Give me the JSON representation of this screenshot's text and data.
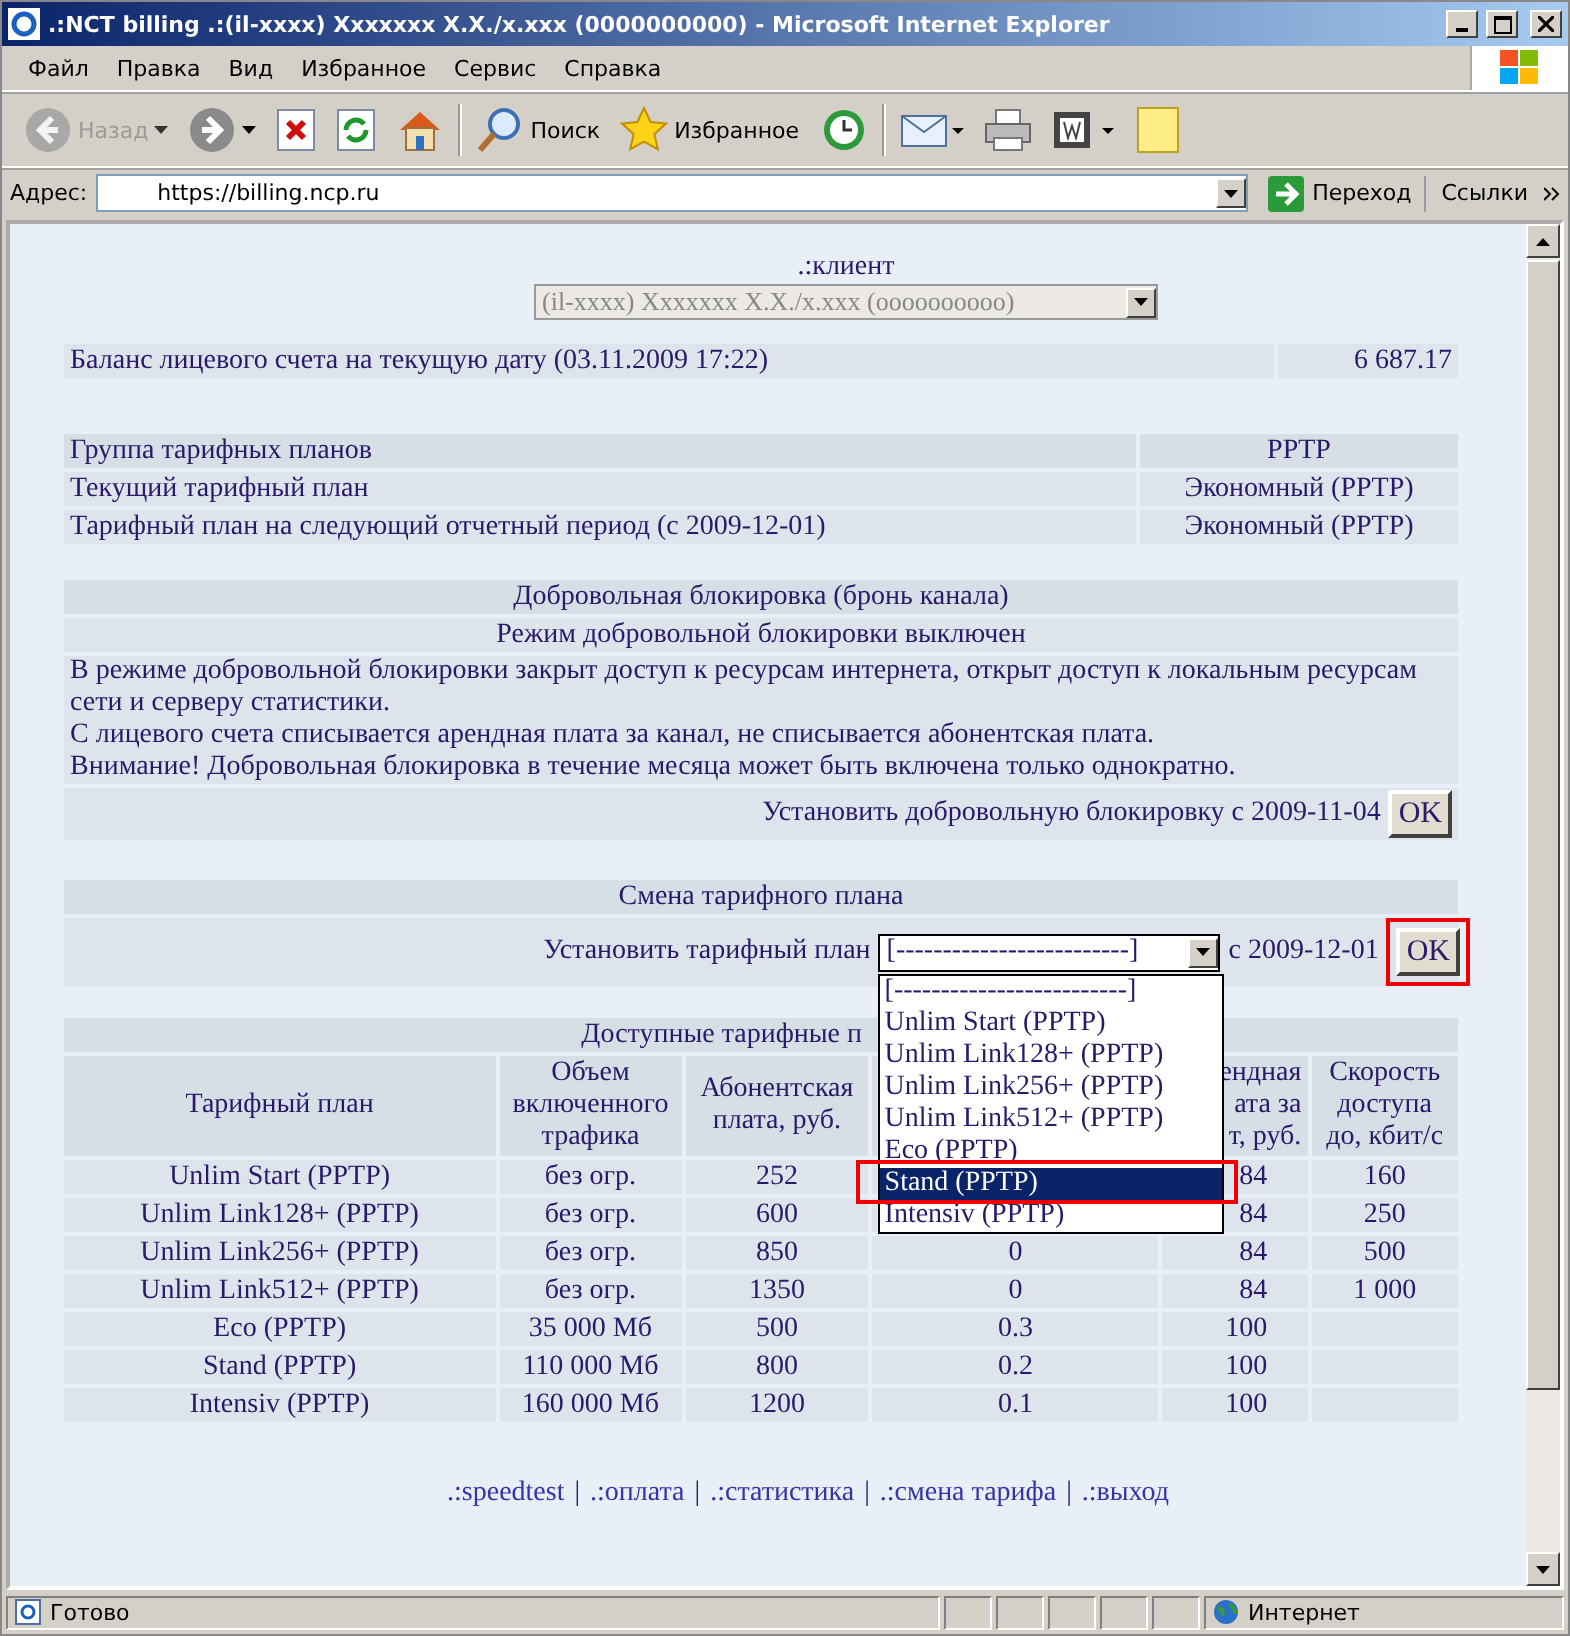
{
  "window": {
    "title": ".:NCT billing .:(il-xxxx) Xxxxxxx X.X./x.xxx (0000000000) - Microsoft Internet Explorer"
  },
  "menu": [
    "Файл",
    "Правка",
    "Вид",
    "Избранное",
    "Сервис",
    "Справка"
  ],
  "toolbar": [
    {
      "kind": "back",
      "label": "Назад",
      "disabled": true
    },
    {
      "kind": "forward",
      "disabled": false
    },
    {
      "kind": "stop",
      "disabled": false
    },
    {
      "kind": "refresh",
      "disabled": false
    },
    {
      "kind": "home",
      "disabled": false
    },
    {
      "kind": "search",
      "label": "Поиск",
      "disabled": false
    },
    {
      "kind": "favorites",
      "label": "Избранное",
      "disabled": false
    },
    {
      "kind": "history",
      "disabled": false
    },
    {
      "kind": "mail",
      "disabled": false
    },
    {
      "kind": "print",
      "disabled": false
    },
    {
      "kind": "edit",
      "disabled": false
    },
    {
      "kind": "note",
      "disabled": false
    }
  ],
  "address": {
    "label": "Адрес:",
    "value": "https://billing.ncp.ru",
    "go": "Переход",
    "links": "Ссылки"
  },
  "client": {
    "label": ".:клиент",
    "value": "(il-xxxx) Xxxxxxx X.X./x.xxx (oooooooooo)",
    "disabled": true
  },
  "balance": {
    "label": "Баланс лицевого счета на текущую дату (03.11.2009 17:22)",
    "value": "6 687.17"
  },
  "plan_info": [
    {
      "label": "Группа тарифных планов",
      "value": "PPTP"
    },
    {
      "label": "Текущий тарифный план",
      "value": "Экономный (PPTP)"
    },
    {
      "label": "Тарифный план на следующий отчетный период (с 2009-12-01)",
      "value": "Экономный (PPTP)"
    }
  ],
  "block": {
    "title": "Добровольная блокировка (бронь канала)",
    "status": "Режим добровольной блокировки выключен",
    "notes": [
      "В режиме добровольной блокировки закрыт доступ к ресурсам интернета, открыт доступ к локальным ресурсам сети и серверу статистики.",
      "С лицевого счета списывается арендная плата за канал, не списывается абонентская плата.",
      "Внимание! Добровольная блокировка в течение месяца может быть включена только однократно."
    ],
    "action": "Установить добровольную блокировку с 2009-11-04",
    "button": "OK"
  },
  "change": {
    "title": "Смена тарифного плана",
    "label": "Установить тарифный план",
    "select_value": "[-------------------------]",
    "date": "с 2009-12-01",
    "button": "OK",
    "button_highlighted": true,
    "expanded": true,
    "options": [
      {
        "label": "[-------------------------]",
        "selected": false,
        "highlighted": false
      },
      {
        "label": "Unlim Start (PPTP)",
        "selected": false,
        "highlighted": false
      },
      {
        "label": "Unlim Link128+ (PPTP)",
        "selected": false,
        "highlighted": false
      },
      {
        "label": "Unlim Link256+ (PPTP)",
        "selected": false,
        "highlighted": false
      },
      {
        "label": "Unlim Link512+ (PPTP)",
        "selected": false,
        "highlighted": false
      },
      {
        "label": "Eco (PPTP)",
        "selected": false,
        "highlighted": false
      },
      {
        "label": "Stand (PPTP)",
        "selected": true,
        "highlighted": true
      },
      {
        "label": "Intensiv (PPTP)",
        "selected": false,
        "highlighted": false
      }
    ]
  },
  "tariffs": {
    "title": "Доступные тарифные п",
    "columns": {
      "plan": "Тарифный план",
      "traffic": "Объем включенного трафика",
      "fee": "Абонентская плата, руб.",
      "column_5": "ендная\nата за\nт, руб.",
      "speed": "Скорость доступа до, кбит/с"
    },
    "rows": [
      {
        "plan": "Unlim Start (PPTP)",
        "traffic": "без огр.",
        "fee": "252",
        "column_5": "84",
        "speed": "160"
      },
      {
        "plan": "Unlim Link128+ (PPTP)",
        "traffic": "без огр.",
        "fee": "600",
        "column_5": "84",
        "speed": "250"
      },
      {
        "plan": "Unlim Link256+ (PPTP)",
        "traffic": "без огр.",
        "fee": "850",
        "column_4": "0",
        "column_5": "84",
        "speed": "500"
      },
      {
        "plan": "Unlim Link512+ (PPTP)",
        "traffic": "без огр.",
        "fee": "1350",
        "column_4": "0",
        "column_5": "84",
        "speed": "1 000"
      },
      {
        "plan": "Eco (PPTP)",
        "traffic": "35 000 Мб",
        "fee": "500",
        "column_4": "0.3",
        "column_5": "100"
      },
      {
        "plan": "Stand (PPTP)",
        "traffic": "110 000 Мб",
        "fee": "800",
        "column_4": "0.2",
        "column_5": "100"
      },
      {
        "plan": "Intensiv (PPTP)",
        "traffic": "160 000 Мб",
        "fee": "1200",
        "column_4": "0.1",
        "column_5": "100"
      }
    ]
  },
  "footer_links": [
    ".:speedtest",
    ".:оплата",
    ".:статистика",
    ".:смена тарифа",
    ".:выход"
  ],
  "link_separator": "|",
  "status": {
    "text": "Готово",
    "zone": "Интернет"
  }
}
